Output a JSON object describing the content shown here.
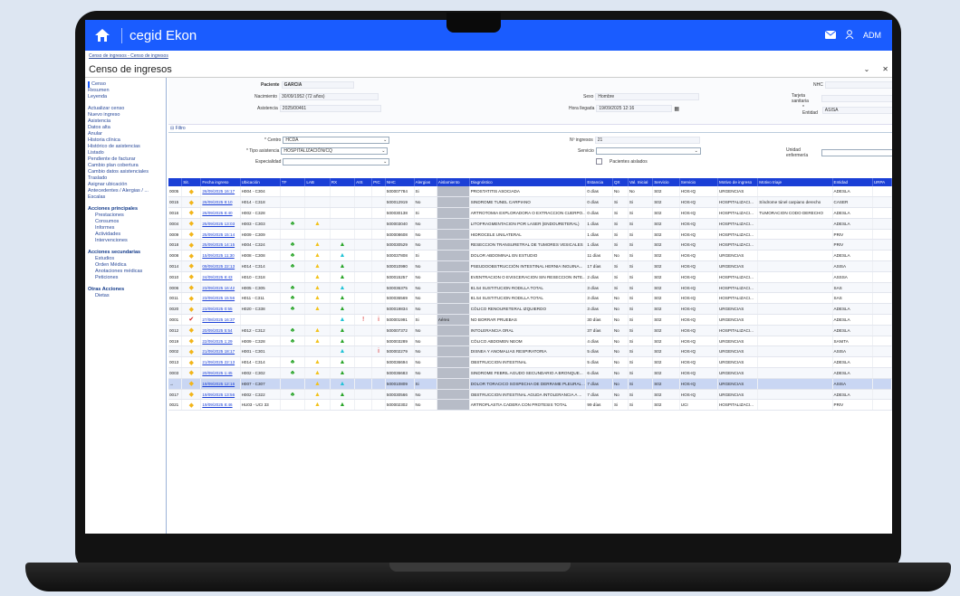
{
  "app": {
    "brand": "cegid Ekon",
    "user": "ADM"
  },
  "breadcrumb": "Censo de ingresos - Censo de ingresos",
  "page_title": "Censo de ingresos",
  "sidebar": {
    "top": [
      "Censo",
      "Resumen",
      "Leyenda"
    ],
    "actions": [
      "Actualizar censo",
      "Nuevo ingreso",
      "Asistencia",
      "Datos alta",
      "Anular",
      "Historia clínica",
      "Histórico de asistencias",
      "Listado",
      "Pendiente de facturar",
      "Cambio plan cobertura",
      "Cambio datos asistenciales",
      "Traslado",
      "Asignar ubicación",
      "Antecedentes / Alergias / ...",
      "Escalas"
    ],
    "sections": [
      {
        "title": "Acciones principales",
        "items": [
          "Prestaciones",
          "Consumos",
          "Informes",
          "Actividades",
          "Intervenciones"
        ]
      },
      {
        "title": "Acciones secundarias",
        "items": [
          "Estudios",
          "Orden Médica",
          "Anotaciones médicas",
          "Peticiones"
        ]
      },
      {
        "title": "Otras Acciones",
        "items": [
          "Dietas"
        ]
      }
    ]
  },
  "header": {
    "paciente_label": "Paciente",
    "paciente": "GARCIA",
    "nacimiento_label": "Nacimiento",
    "nacimiento": "30/09/1952 (72 años)",
    "asistencia_label": "Asistencia",
    "asistencia": "2025/00461",
    "sexo_label": "Sexo",
    "sexo": "Hombre",
    "hora_label": "Hora llegada",
    "hora": "19/09/2025 12:16",
    "nhc_label": "NHC",
    "tarjeta_label": "Tarjeta sanitaria",
    "entidad_label": "* Entidad",
    "entidad": "ASISA"
  },
  "filtro": {
    "title": "Filtro",
    "centro_label": "* Centro",
    "centro": "HCDA",
    "tipo_label": "* Tipo asistencia",
    "tipo": "HOSPITALIZACIÓN/CQ",
    "esp_label": "Especialidad",
    "ningresos_label": "Nº ingresos",
    "ningresos": "21",
    "servicio_label": "Servicio",
    "aislados_label": "Pacientes aislados",
    "unidad_label": "Unidad enfermería"
  },
  "table": {
    "columns": [
      "",
      "Sit.",
      "Fecha ingreso",
      "Ubicación",
      "TF",
      "LAB",
      "RX",
      "AIS",
      "PIC",
      "NHC",
      "Alergias",
      "Aislamiento",
      "Diagnóstico",
      "Estancia",
      "QX",
      "Val. Inicial",
      "Servicio",
      "Servicio",
      "Motivo de ingreso",
      "Motivo triaje",
      "Entidad",
      "URPA"
    ],
    "rows": [
      [
        "0005",
        "◆",
        "26/09/2025 16:17",
        "H004 - C304",
        "",
        "",
        "",
        "",
        "",
        "500007784",
        "Si",
        "",
        "PROSTATITIS ASOCIADA",
        "0 días",
        "No",
        "No",
        "S02",
        "HOS-IQ",
        "URGENCIAS",
        "",
        "ADESLA",
        ""
      ],
      [
        "0015",
        "◆",
        "26/09/2025 9:10",
        "H014 - C318",
        "",
        "",
        "",
        "",
        "",
        "500012919",
        "No",
        "",
        "SINDROME TUNEL CARPIANO",
        "0 días",
        "Si",
        "Si",
        "S02",
        "HOS-IQ",
        "HOSPITALIZACI...",
        "Síndrome túnel carpiano derecho",
        "CASER",
        ""
      ],
      [
        "0016",
        "◆",
        "26/09/2025 8:40",
        "H002 - C328",
        "",
        "",
        "",
        "",
        "",
        "500030138",
        "Si",
        "",
        "ARTROTOMIA EXPLORADORA O EXTRACCION CUERPO...",
        "0 días",
        "Si",
        "Si",
        "S02",
        "HOS-IQ",
        "HOSPITALIZACI...",
        "TUMORACION CODO DERECHO",
        "ADESLA",
        ""
      ],
      [
        "0004",
        "◆",
        "25/09/2025 13:03",
        "H003 - C303",
        "♣",
        "▲",
        "",
        "",
        "",
        "500003040",
        "No",
        "",
        "LITOFRAGMENTACION POR LASER (ENDOURETERAL)",
        "1 días",
        "Si",
        "Si",
        "S02",
        "HOS-IQ",
        "HOSPITALIZACI...",
        "",
        "ADESLA",
        ""
      ],
      [
        "0009",
        "◆",
        "25/09/2025 15:14",
        "H009 - C309",
        "",
        "",
        "",
        "",
        "",
        "500008608",
        "No",
        "",
        "HIDROCELE UNILATERAL",
        "1 días",
        "Si",
        "Si",
        "S02",
        "HOS-IQ",
        "HOSPITALIZACI...",
        "",
        "PRIV",
        ""
      ],
      [
        "0018",
        "◆",
        "25/09/2025 14:15",
        "H004 - C324",
        "♣",
        "▲",
        "▲",
        "",
        "",
        "500030529",
        "No",
        "",
        "RESECCION TRANSURETRAL DE TUMORES VESICALES",
        "1 días",
        "Si",
        "Si",
        "S02",
        "HOS-IQ",
        "HOSPITALIZACI...",
        "",
        "PRIV",
        ""
      ],
      [
        "0008",
        "◆",
        "15/09/2025 11:30",
        "H008 - C308",
        "♣",
        "▲",
        "▲",
        "",
        "",
        "500037808",
        "Si",
        "",
        "DOLOR ABDOMINAL EN ESTUDIO",
        "11 días",
        "No",
        "Si",
        "S02",
        "HOS-IQ",
        "URGENCIAS",
        "",
        "ADESLA",
        ""
      ],
      [
        "0014",
        "◆",
        "09/09/2025 22:13",
        "H014 - C314",
        "♣",
        "▲",
        "▲",
        "",
        "",
        "500010990",
        "No",
        "",
        "PSEUDOOBSTRUCCIÓN INTESTINAL HERNIA INGUINA...",
        "17 días",
        "Si",
        "Si",
        "S02",
        "HOS-IQ",
        "URGENCIAS",
        "",
        "ASISA",
        ""
      ],
      [
        "0010",
        "◆",
        "24/09/2025 8:43",
        "H010 - C318",
        "",
        "▲",
        "▲",
        "",
        "",
        "500015257",
        "No",
        "",
        "EVENTRACION O EVISCERACION SIN RESECCION INTE...",
        "2 días",
        "Si",
        "Si",
        "S02",
        "HOS-IQ",
        "HOSPITALIZACI...",
        "",
        "ASSSA",
        ""
      ],
      [
        "0006",
        "◆",
        "23/09/2025 16:42",
        "H005 - C305",
        "♣",
        "▲",
        "▲",
        "",
        "",
        "500036375",
        "No",
        "",
        "81.54 SUSTITUCION RODILLA TOTAL",
        "3 días",
        "Si",
        "Si",
        "S02",
        "HOS-IQ",
        "HOSPITALIZACI...",
        "",
        "SAS",
        ""
      ],
      [
        "0011",
        "◆",
        "23/09/2025 15:56",
        "H011 - C311",
        "♣",
        "▲",
        "▲",
        "",
        "",
        "500036569",
        "No",
        "",
        "81.54 SUSTITUCION RODILLA TOTAL",
        "3 días",
        "No",
        "Si",
        "S02",
        "HOS-IQ",
        "HOSPITALIZACI...",
        "",
        "SAS",
        ""
      ],
      [
        "0020",
        "◆",
        "23/09/2025 0:55",
        "H020 - C338",
        "♣",
        "▲",
        "▲",
        "",
        "",
        "500019834",
        "No",
        "",
        "CÓLICO RENOURETERAL IZQUIERDO",
        "3 días",
        "No",
        "Si",
        "S02",
        "HOS-IQ",
        "URGENCIAS",
        "",
        "ADESLA",
        ""
      ],
      [
        "0001",
        "✔",
        "27/08/2025 16:37",
        "",
        "",
        "",
        "▲",
        "!",
        "i",
        "500001991",
        "Si",
        "Aéreo",
        "NO BORRAR PRUEBAS",
        "30 días",
        "No",
        "Si",
        "S02",
        "HOS-IQ",
        "URGENCIAS",
        "",
        "ADESLA",
        ""
      ],
      [
        "0012",
        "◆",
        "20/09/2025 5:54",
        "H012 - C312",
        "♣",
        "▲",
        "▲",
        "",
        "",
        "500007372",
        "No",
        "",
        "INTOLERANCIA ORAL",
        "37 días",
        "No",
        "Si",
        "S02",
        "HOS-IQ",
        "HOSPITALIZACI...",
        "",
        "ADESLA",
        ""
      ],
      [
        "0019",
        "◆",
        "22/09/2025 1:29",
        "H009 - C328",
        "♣",
        "▲",
        "▲",
        "",
        "",
        "500003289",
        "No",
        "",
        "CÓLICO ABDOMEN NEOM",
        "4 días",
        "No",
        "Si",
        "S02",
        "HOS-IQ",
        "URGENCIAS",
        "",
        "SANITA",
        ""
      ],
      [
        "0002",
        "◆",
        "21/09/2025 18:17",
        "H001 - C301",
        "",
        "",
        "▲",
        "",
        "i",
        "500002279",
        "No",
        "",
        "DISNEA Y ANOMALIAS RESPIRATORIA",
        "5 días",
        "No",
        "Si",
        "S02",
        "HOS-IQ",
        "URGENCIAS",
        "",
        "ASISA",
        ""
      ],
      [
        "0013",
        "◆",
        "21/09/2025 22:13",
        "H014 - C314",
        "♣",
        "▲",
        "▲",
        "",
        "",
        "500036694",
        "No",
        "",
        "OBSTRUCCION INTESTINAL",
        "5 días",
        "No",
        "Si",
        "S02",
        "HOS-IQ",
        "URGENCIAS",
        "",
        "ADESLA",
        ""
      ],
      [
        "0003",
        "◆",
        "20/09/2025 1:45",
        "H002 - C302",
        "♣",
        "▲",
        "▲",
        "",
        "",
        "500036683",
        "No",
        "",
        "SINDROME FEBRIL AGUDO SECUNDARIO A BRONQUE...",
        "6 días",
        "No",
        "Si",
        "S02",
        "HOS-IQ",
        "URGENCIAS",
        "",
        "ADESLA",
        ""
      ],
      [
        "→",
        "◆",
        "19/09/2025 12:16",
        "H007 - C307",
        "",
        "▲",
        "▲",
        "",
        "",
        "500010809",
        "Si",
        "",
        "DOLOR TORACICO SOSPECHA DE DERRAME PLEURAL ...",
        "7 días",
        "No",
        "Si",
        "S02",
        "HOS-IQ",
        "URGENCIAS",
        "",
        "ASISA",
        ""
      ],
      [
        "0017",
        "◆",
        "19/09/2025 13:56",
        "H002 - C322",
        "♣",
        "▲",
        "▲",
        "",
        "",
        "500030566",
        "No",
        "",
        "OBSTRUCCION INTESTINAL AGUDA INTOLERANCIA A ...",
        "7 días",
        "No",
        "Si",
        "S02",
        "HOS-IQ",
        "URGENCIAS",
        "",
        "ADESLA",
        ""
      ],
      [
        "0021",
        "◆",
        "19/09/2025 8:46",
        "HU03 - UCI 33",
        "",
        "▲",
        "▲",
        "",
        "",
        "500002302",
        "No",
        "",
        "ARTROPLASTIA CADERA CON PROTESIS TOTAL",
        "99 días",
        "Si",
        "Si",
        "S02",
        "UCI",
        "HOSPITALIZACI...",
        "",
        "PRIV",
        ""
      ]
    ]
  }
}
